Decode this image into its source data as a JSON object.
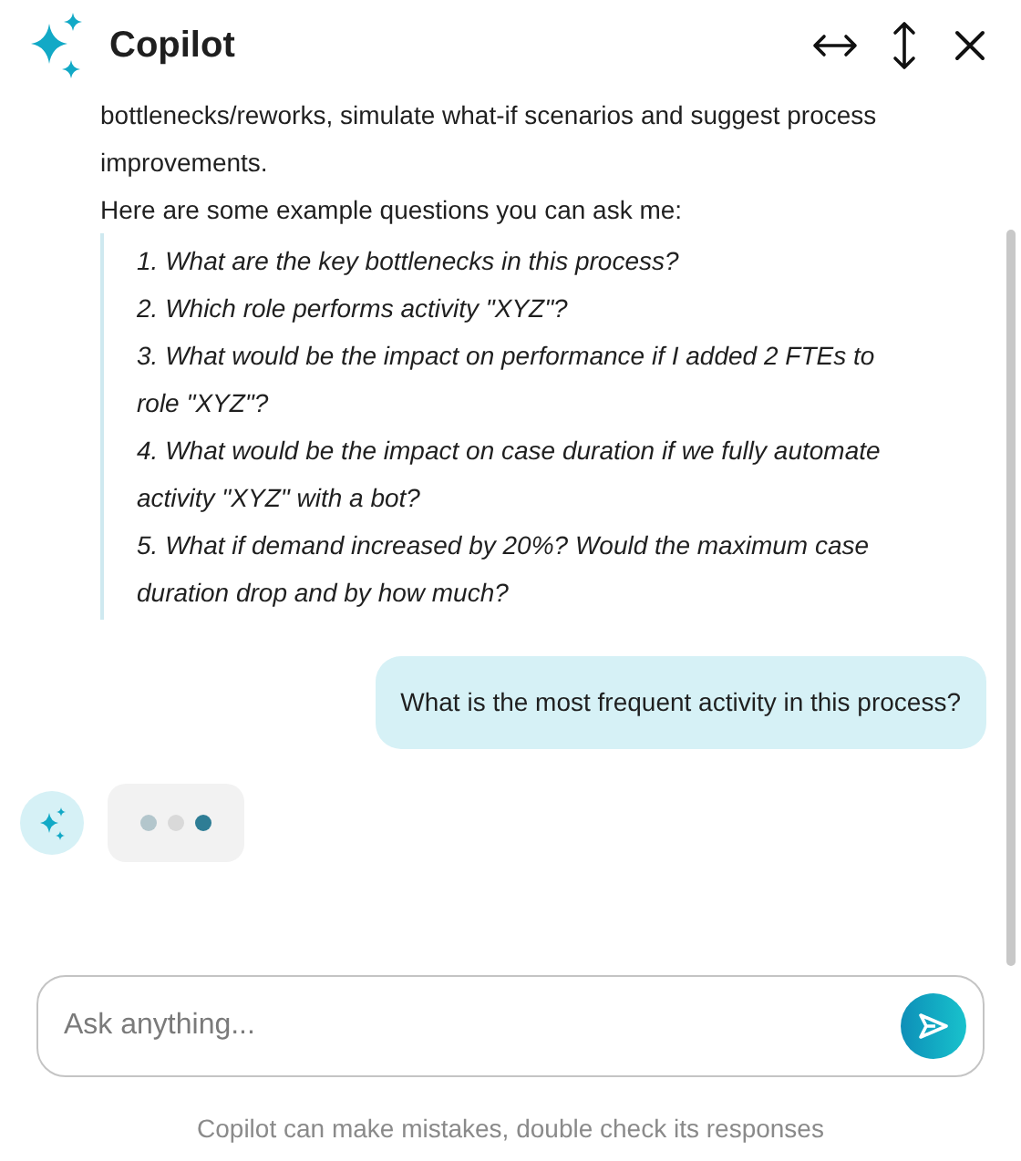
{
  "header": {
    "title": "Copilot"
  },
  "messages": [
    {
      "kind": "assistant",
      "paragraphs": [
        "bottlenecks/reworks, simulate what-if scenarios and suggest process improvements.",
        "Here are some example questions you can ask me:"
      ],
      "examples": [
        "1. What are the key bottlenecks in this process?",
        "2. Which role performs activity \"XYZ\"?",
        "3. What would be the impact on performance if I added 2 FTEs to role \"XYZ\"?",
        "4. What would be the impact on case duration if we fully automate activity \"XYZ\" with a bot?",
        "5. What if demand increased by 20%? Would the maximum case duration drop and by how much?"
      ]
    },
    {
      "kind": "user",
      "text": "What is the most frequent activity in this process?"
    },
    {
      "kind": "typing"
    }
  ],
  "composer": {
    "placeholder": "Ask anything..."
  },
  "disclaimer": "Copilot can make mistakes, double check its responses"
}
